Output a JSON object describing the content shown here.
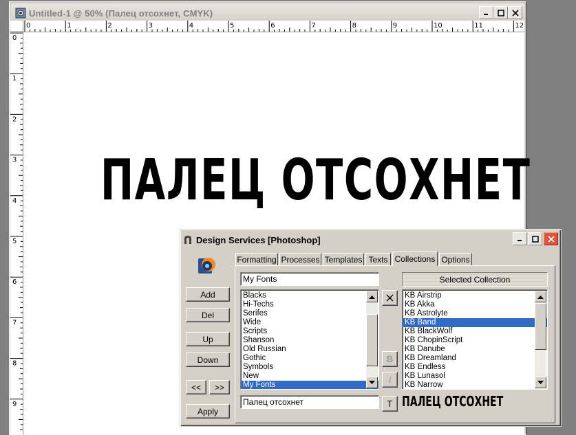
{
  "document": {
    "title": "Untitled-1 @ 50% (Палец отсохнет, CMYK)",
    "canvas_text": "ПАЛЕЦ ОТСОХНЕТ",
    "ruler_top": [
      "0",
      "1",
      "2",
      "3",
      "4",
      "5",
      "6",
      "7",
      "8",
      "9",
      "10",
      "11",
      "12"
    ],
    "ruler_left": [
      "0",
      "1",
      "2",
      "3",
      "4",
      "5",
      "6",
      "7",
      "8",
      "9"
    ]
  },
  "dialog": {
    "title": "Design Services  [Photoshop]",
    "tabs": [
      "Formatting",
      "Processes",
      "Templates",
      "Texts",
      "Collections",
      "Options"
    ],
    "active_tab": "Collections",
    "left_buttons": {
      "add": "Add",
      "del": "Del",
      "up": "Up",
      "down": "Down",
      "prev": "<<",
      "next": ">>",
      "apply": "Apply"
    },
    "collection_name": "My Fonts",
    "collections": [
      "Blacks",
      "Hi-Techs",
      "Serifes",
      "Wide",
      "Scripts",
      "Shanson",
      "Old Russian",
      "Gothic",
      "Symbols",
      "New",
      "My Fonts"
    ],
    "selected_collection_label": "Selected Collection",
    "fonts": [
      "KB Airstrip",
      "KB Akka",
      "KB Astrolyte",
      "KB Band",
      "KB BlackWolf",
      "KB ChopinScript",
      "KB Danube",
      "KB Dreamland",
      "KB Endless",
      "KB Lunasol",
      "KB Narrow"
    ],
    "selected_font": "KB Band",
    "sample_text": "Палец отсохнет",
    "preview_text": "ПАЛЕЦ ОТСОХНЕТ",
    "side_buttons": {
      "remove": "X",
      "bold": "B",
      "italic": "I",
      "text": "T"
    }
  }
}
